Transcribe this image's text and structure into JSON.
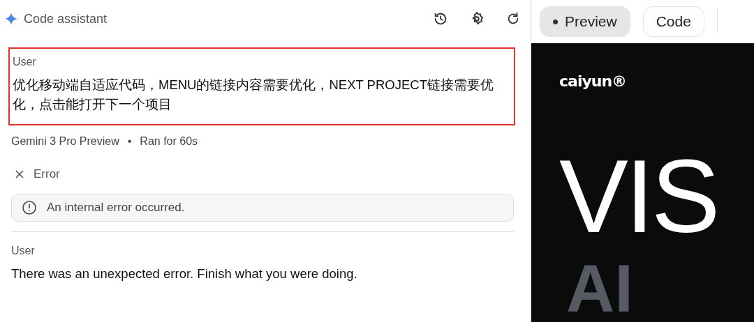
{
  "header": {
    "title": "Code assistant"
  },
  "messages": [
    {
      "kind": "user",
      "author": "User",
      "text": "优化移动端自适应代码，MENU的链接内容需要优化，NEXT PROJECT链接需要优化，点击能打开下一个项目",
      "highlighted": true
    },
    {
      "kind": "model",
      "model": "Gemini 3 Pro Preview",
      "separator": "•",
      "runtime": "Ran for 60s",
      "status": "Error",
      "error": "An internal error occurred."
    },
    {
      "kind": "user",
      "author": "User",
      "text": "There was an unexpected error. Finish what you were doing.",
      "highlighted": false
    }
  ],
  "tabs": [
    {
      "label": "Preview",
      "selected": true
    },
    {
      "label": "Code",
      "selected": false
    }
  ],
  "preview": {
    "logo": "caiyun®",
    "headline": "VIS",
    "subline": "AI"
  }
}
